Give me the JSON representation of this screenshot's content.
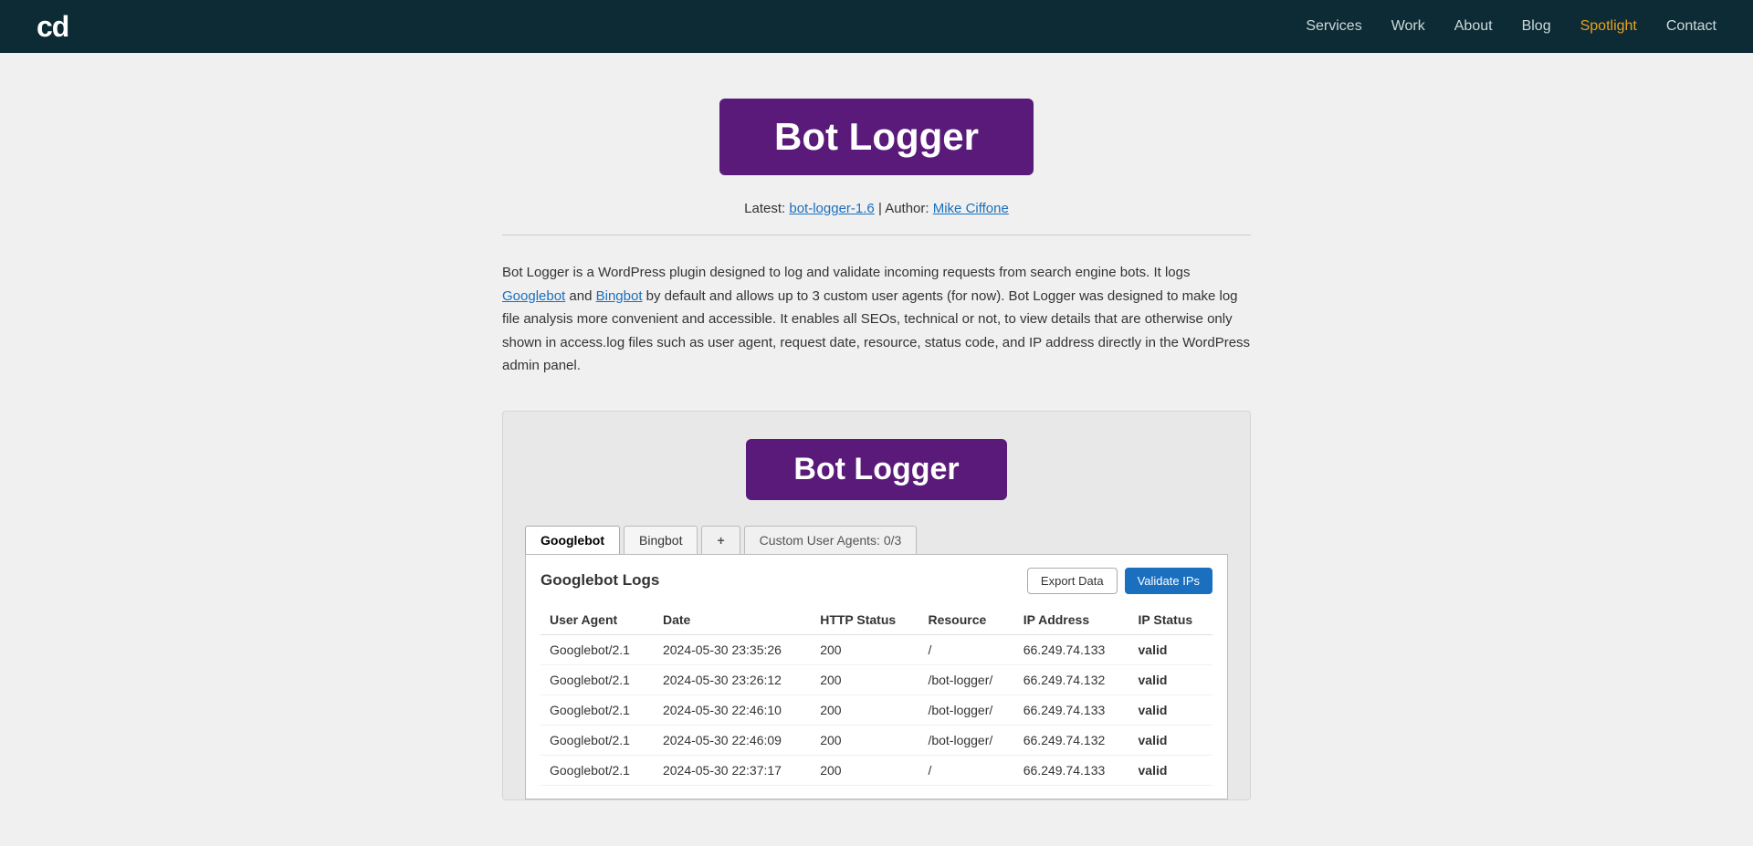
{
  "nav": {
    "logo": "cd",
    "links": [
      {
        "label": "Services",
        "id": "services",
        "active": false
      },
      {
        "label": "Work",
        "id": "work",
        "active": false
      },
      {
        "label": "About",
        "id": "about",
        "active": false
      },
      {
        "label": "Blog",
        "id": "blog",
        "active": false
      },
      {
        "label": "Spotlight",
        "id": "spotlight",
        "active": true,
        "highlight": true
      },
      {
        "label": "Contact",
        "id": "contact",
        "active": false
      }
    ]
  },
  "hero": {
    "title": "Bot Logger",
    "meta_latest_label": "Latest:",
    "meta_latest_link_text": "bot-logger-1.6",
    "meta_latest_link_href": "#",
    "meta_separator": "|",
    "meta_author_label": "Author:",
    "meta_author_link_text": "Mike Ciffone",
    "meta_author_link_href": "#"
  },
  "description": {
    "text_before_googlebot": "Bot Logger is a WordPress plugin designed to log and validate incoming requests from search engine bots. It logs ",
    "googlebot_link": "Googlebot",
    "text_between": " and ",
    "bingbot_link": "Bingbot",
    "text_after": " by default and allows up to 3 custom user agents (for now). Bot Logger was designed to make log file analysis more convenient and accessible. It enables all SEOs, technical or not, to view details that are otherwise only shown in access.log files such as user agent, request date, resource, status code, and IP address directly in the WordPress admin panel."
  },
  "plugin_preview": {
    "badge_title": "Bot Logger",
    "tabs": [
      {
        "label": "Googlebot",
        "active": true
      },
      {
        "label": "Bingbot",
        "active": false
      },
      {
        "label": "+",
        "active": false,
        "type": "plus"
      },
      {
        "label": "Custom User Agents: 0/3",
        "active": false,
        "type": "custom"
      }
    ],
    "table_title": "Googlebot Logs",
    "btn_export": "Export Data",
    "btn_validate": "Validate IPs",
    "columns": [
      "User Agent",
      "Date",
      "HTTP Status",
      "Resource",
      "IP Address",
      "IP Status"
    ],
    "rows": [
      {
        "user_agent": "Googlebot/2.1",
        "date": "2024-05-30 23:35:26",
        "http_status": "200",
        "resource": "/",
        "ip_address": "66.249.74.133",
        "ip_status": "valid"
      },
      {
        "user_agent": "Googlebot/2.1",
        "date": "2024-05-30 23:26:12",
        "http_status": "200",
        "resource": "/bot-logger/",
        "ip_address": "66.249.74.132",
        "ip_status": "valid"
      },
      {
        "user_agent": "Googlebot/2.1",
        "date": "2024-05-30 22:46:10",
        "http_status": "200",
        "resource": "/bot-logger/",
        "ip_address": "66.249.74.133",
        "ip_status": "valid"
      },
      {
        "user_agent": "Googlebot/2.1",
        "date": "2024-05-30 22:46:09",
        "http_status": "200",
        "resource": "/bot-logger/",
        "ip_address": "66.249.74.132",
        "ip_status": "valid"
      },
      {
        "user_agent": "Googlebot/2.1",
        "date": "2024-05-30 22:37:17",
        "http_status": "200",
        "resource": "/",
        "ip_address": "66.249.74.133",
        "ip_status": "valid"
      }
    ]
  }
}
